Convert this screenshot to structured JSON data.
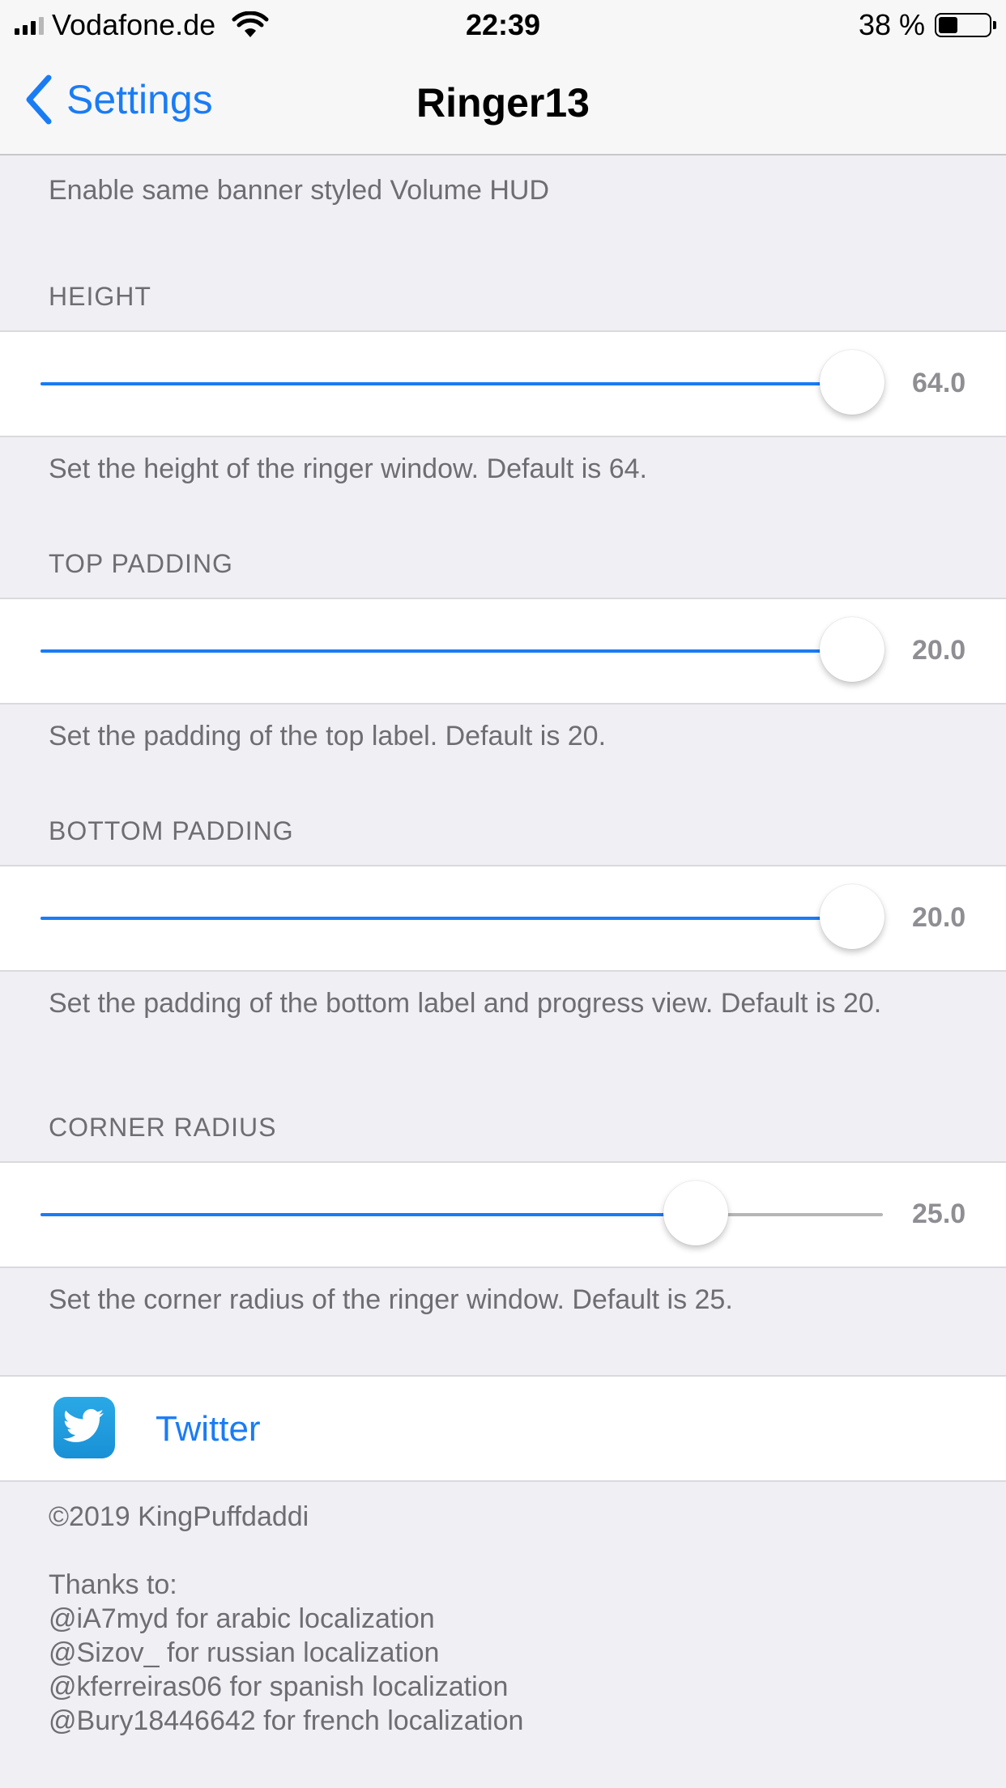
{
  "status": {
    "carrier": "Vodafone.de",
    "time": "22:39",
    "battery": "38 %",
    "battery_level": 0.38
  },
  "nav": {
    "back_label": "Settings",
    "title": "Ringer13"
  },
  "top_footer": "Enable same banner styled Volume HUD",
  "sliders": [
    {
      "header": "HEIGHT",
      "value": 64,
      "value_text": "64.0",
      "fraction": 0.963,
      "footer": "Set the height of the ringer window. Default is 64."
    },
    {
      "header": "TOP PADDING",
      "value": 20,
      "value_text": "20.0",
      "fraction": 0.963,
      "footer": "Set the padding of the top label. Default is 20."
    },
    {
      "header": "BOTTOM PADDING",
      "value": 20,
      "value_text": "20.0",
      "fraction": 0.963,
      "footer": "Set the padding of the bottom label and progress view. Default is 20."
    },
    {
      "header": "CORNER RADIUS",
      "value": 25,
      "value_text": "25.0",
      "fraction": 0.778,
      "footer": "Set the corner radius of the ringer window. Default is 25."
    }
  ],
  "twitter": {
    "label": "Twitter",
    "icon": "twitter-bird-icon"
  },
  "copyright": "©2019 KingPuffdaddi",
  "thanks": "Thanks to:\n@iA7myd for arabic localization\n@Sizov_ for russian localization\n@kferreiras06 for spanish localization\n@Bury18446642 for french localization",
  "colors": {
    "accent": "#1a7cf5",
    "background": "#efeff4",
    "secondary_text": "#6d6d72"
  }
}
